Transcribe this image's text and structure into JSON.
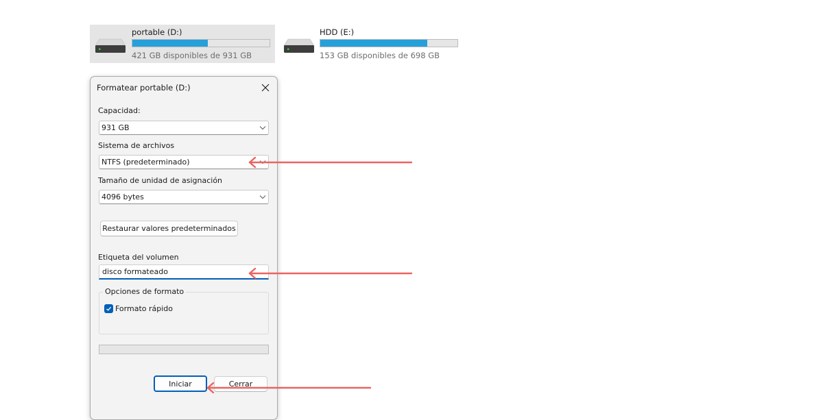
{
  "drives": [
    {
      "name": "portable (D:)",
      "free_text": "421 GB disponibles de 931 GB",
      "used_fraction": 0.548,
      "selected": true,
      "icon": "hard-drive-icon"
    },
    {
      "name": "HDD (E:)",
      "free_text": "153 GB disponibles de 698 GB",
      "used_fraction": 0.781,
      "selected": false,
      "icon": "hard-drive-icon"
    }
  ],
  "dialog": {
    "title": "Formatear portable (D:)",
    "capacity": {
      "label": "Capacidad:",
      "value": "931 GB"
    },
    "filesystem": {
      "label": "Sistema de archivos",
      "value": "NTFS (predeterminado)"
    },
    "allocation": {
      "label": "Tamaño de unidad de asignación",
      "value": "4096 bytes"
    },
    "restore_button": "Restaurar valores predeterminados",
    "volume_label": {
      "label": "Etiqueta del volumen",
      "value": "disco formateado"
    },
    "format_options": {
      "legend": "Opciones de formato",
      "quick_format": {
        "label": "Formato rápido",
        "checked": true
      }
    },
    "progress_fraction": 0,
    "start_button": "Iniciar",
    "close_button": "Cerrar"
  },
  "colors": {
    "accent": "#005fb8",
    "bar_fill": "#26a0da",
    "annotation_arrow": "#e96460"
  }
}
